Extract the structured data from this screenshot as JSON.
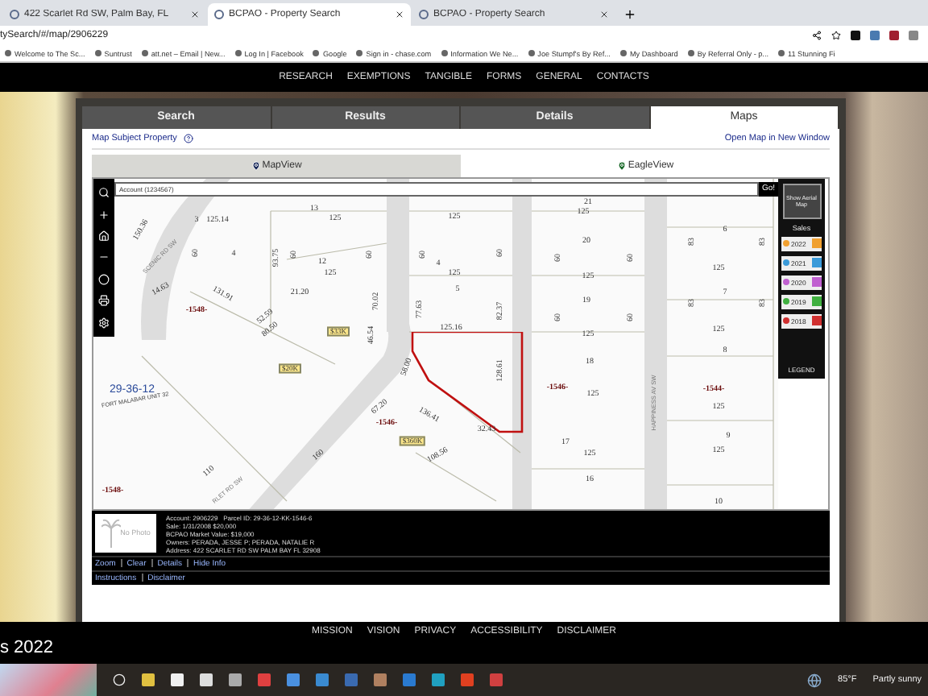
{
  "browser": {
    "tabs": [
      {
        "title": "422 Scarlet Rd SW, Palm Bay, FL",
        "selected": false
      },
      {
        "title": "BCPAO - Property Search",
        "selected": true
      },
      {
        "title": "BCPAO - Property Search",
        "selected": false
      }
    ],
    "url": "tySearch/#/map/2906229",
    "bookmarks": [
      "Welcome to The Sc...",
      "Suntrust",
      "att.net – Email | New...",
      "Log In | Facebook",
      "Google",
      "Sign in - chase.com",
      "Information We Ne...",
      "Joe Stumpf's By Ref...",
      "My Dashboard",
      "By Referral Only - p...",
      "11 Stunning Fi"
    ]
  },
  "nav": [
    "RESEARCH",
    "EXEMPTIONS",
    "TANGIBLE",
    "FORMS",
    "GENERAL",
    "CONTACTS"
  ],
  "tabs": [
    {
      "label": "Search",
      "selected": false
    },
    {
      "label": "Results",
      "selected": false
    },
    {
      "label": "Details",
      "selected": false
    },
    {
      "label": "Maps",
      "selected": true
    }
  ],
  "map_subject_link": "Map Subject Property",
  "open_map_link": "Open Map in New Window",
  "view_tabs": [
    {
      "label": "MapView",
      "selected": true
    },
    {
      "label": "EagleView",
      "selected": false
    }
  ],
  "map_search": {
    "placeholder": "Account (1234567)",
    "button": "Go!"
  },
  "map_labels": [
    {
      "text": "3",
      "kind": "lot"
    },
    {
      "text": "125.14",
      "kind": "dim"
    },
    {
      "text": "13",
      "kind": "lot"
    },
    {
      "text": "125",
      "kind": "dim"
    },
    {
      "text": "150.36",
      "kind": "dim"
    },
    {
      "text": "SCENIC RD SW",
      "kind": "street"
    },
    {
      "text": "60",
      "kind": "dim"
    },
    {
      "text": "4",
      "kind": "lot"
    },
    {
      "text": "93.75",
      "kind": "dim"
    },
    {
      "text": "60",
      "kind": "dim"
    },
    {
      "text": "12",
      "kind": "lot"
    },
    {
      "text": "125",
      "kind": "dim"
    },
    {
      "text": "60",
      "kind": "dim"
    },
    {
      "text": "14.63",
      "kind": "dim"
    },
    {
      "text": "-1548-",
      "kind": "parcel"
    },
    {
      "text": "131.91",
      "kind": "dim"
    },
    {
      "text": "52.59",
      "kind": "dim"
    },
    {
      "text": "80.50",
      "kind": "dim"
    },
    {
      "text": "21.20",
      "kind": "dim"
    },
    {
      "text": "$33K",
      "kind": "value"
    },
    {
      "text": "70.02",
      "kind": "dim"
    },
    {
      "text": "46.54",
      "kind": "dim"
    },
    {
      "text": "125",
      "kind": "dim"
    },
    {
      "text": "60",
      "kind": "dim"
    },
    {
      "text": "4",
      "kind": "lot"
    },
    {
      "text": "125",
      "kind": "dim"
    },
    {
      "text": "60",
      "kind": "dim"
    },
    {
      "text": "5",
      "kind": "lot"
    },
    {
      "text": "77.63",
      "kind": "dim"
    },
    {
      "text": "82.37",
      "kind": "dim"
    },
    {
      "text": "125.16",
      "kind": "dim"
    },
    {
      "text": "21",
      "kind": "lot"
    },
    {
      "text": "125",
      "kind": "dim"
    },
    {
      "text": "20",
      "kind": "lot"
    },
    {
      "text": "60",
      "kind": "dim"
    },
    {
      "text": "60",
      "kind": "dim"
    },
    {
      "text": "125",
      "kind": "dim"
    },
    {
      "text": "19",
      "kind": "lot"
    },
    {
      "text": "60",
      "kind": "dim"
    },
    {
      "text": "60",
      "kind": "dim"
    },
    {
      "text": "125",
      "kind": "dim"
    },
    {
      "text": "6",
      "kind": "lot"
    },
    {
      "text": "83",
      "kind": "dim"
    },
    {
      "text": "83",
      "kind": "dim"
    },
    {
      "text": "125",
      "kind": "dim"
    },
    {
      "text": "7",
      "kind": "lot"
    },
    {
      "text": "83",
      "kind": "dim"
    },
    {
      "text": "83",
      "kind": "dim"
    },
    {
      "text": "125",
      "kind": "dim"
    },
    {
      "text": "$20K",
      "kind": "value"
    },
    {
      "text": "29-36-12",
      "kind": "section"
    },
    {
      "text": "FORT MALABAR UNIT 32",
      "kind": "subdivision"
    },
    {
      "text": "-1548-",
      "kind": "parcel"
    },
    {
      "text": "-1546-",
      "kind": "parcel"
    },
    {
      "text": "$360K",
      "kind": "value"
    },
    {
      "text": "58.00",
      "kind": "dim"
    },
    {
      "text": "136.41",
      "kind": "dim"
    },
    {
      "text": "32.43",
      "kind": "dim"
    },
    {
      "text": "108.56",
      "kind": "dim"
    },
    {
      "text": "67.20",
      "kind": "dim"
    },
    {
      "text": "128.61",
      "kind": "dim"
    },
    {
      "text": "160",
      "kind": "dim"
    },
    {
      "text": "110",
      "kind": "dim"
    },
    {
      "text": "RLET RD SW",
      "kind": "street"
    },
    {
      "text": "HAPPINESS AV SW",
      "kind": "street"
    },
    {
      "text": "18",
      "kind": "lot"
    },
    {
      "text": "-1546-",
      "kind": "parcel"
    },
    {
      "text": "125",
      "kind": "dim"
    },
    {
      "text": "17",
      "kind": "lot"
    },
    {
      "text": "125",
      "kind": "dim"
    },
    {
      "text": "16",
      "kind": "lot"
    },
    {
      "text": "8",
      "kind": "lot"
    },
    {
      "text": "-1544-",
      "kind": "parcel"
    },
    {
      "text": "125",
      "kind": "dim"
    },
    {
      "text": "9",
      "kind": "lot"
    },
    {
      "text": "125",
      "kind": "dim"
    },
    {
      "text": "10",
      "kind": "lot"
    }
  ],
  "legend": {
    "aerial_button": "Show Aerial Map",
    "sales_title": "Sales",
    "years": [
      {
        "label": "2022",
        "color": "#f0a030",
        "checked": true
      },
      {
        "label": "2021",
        "color": "#3a9ad9",
        "checked": true
      },
      {
        "label": "2020",
        "color": "#c060d0",
        "checked": true
      },
      {
        "label": "2019",
        "color": "#40b040",
        "checked": true
      },
      {
        "label": "2018",
        "color": "#d03030",
        "checked": true
      }
    ],
    "legend_button": "LEGEND"
  },
  "info": {
    "photo_text": "No Photo",
    "lines": [
      "Account: 2906229   Parcel ID: 29-36-12-KK-1546-6",
      "Sale: 1/31/2008 $20,000",
      "BCPAO Market Value: $19,000",
      "Owners: PERADA, JESSE P; PERADA, NATALIE R",
      "Address: 422 SCARLET RD SW PALM BAY FL 32908"
    ],
    "actions": [
      "Zoom",
      "Clear",
      "Details",
      "Hide Info"
    ],
    "help_links": [
      "Instructions",
      "Disclaimer"
    ]
  },
  "footer": {
    "links": [
      "MISSION",
      "VISION",
      "PRIVACY",
      "ACCESSIBILITY",
      "DISCLAIMER"
    ],
    "year_text": "s 2022"
  },
  "taskbar": {
    "temperature": "85°F",
    "weather": "Partly sunny"
  }
}
